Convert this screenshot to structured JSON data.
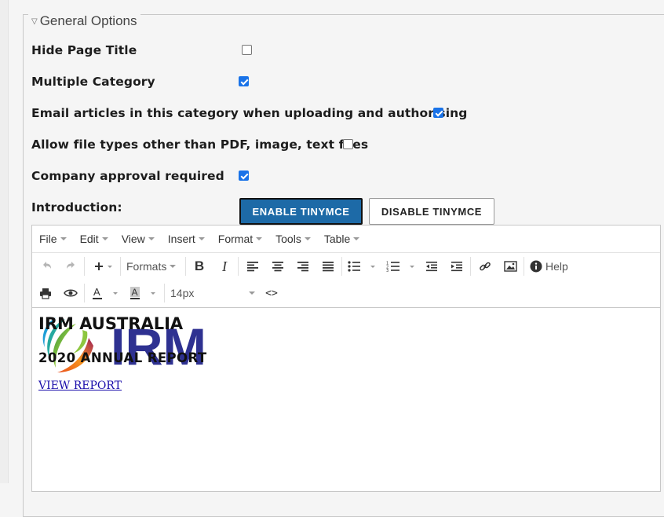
{
  "legend": "General Options",
  "options": [
    {
      "label": "Hide Page Title",
      "checked": false
    },
    {
      "label": "Multiple Category",
      "checked": true
    },
    {
      "label": "Email articles in this category when uploading and authorising",
      "checked": true
    },
    {
      "label": "Allow file types other than PDF, image, text files",
      "checked": false
    },
    {
      "label": "Company approval required",
      "checked": true
    }
  ],
  "introduction_label": "Introduction:",
  "buttons": {
    "enable": "ENABLE TINYMCE",
    "disable": "DISABLE TINYMCE"
  },
  "menubar": [
    "File",
    "Edit",
    "View",
    "Insert",
    "Format",
    "Tools",
    "Table"
  ],
  "toolbar": {
    "formats_label": "Formats",
    "help_label": "Help",
    "font_size": "14px"
  },
  "content": {
    "logo_text": "IRM",
    "heading1": "IRM AUSTRALIA",
    "heading2": "2020 ANNUAL REPORT",
    "link_text": "VIEW REPORT"
  },
  "colors": {
    "primary_button": "#1d6aa7",
    "checkbox": "#1a73e8",
    "logo_text": "#2e3191",
    "link": "#1a0dab"
  }
}
